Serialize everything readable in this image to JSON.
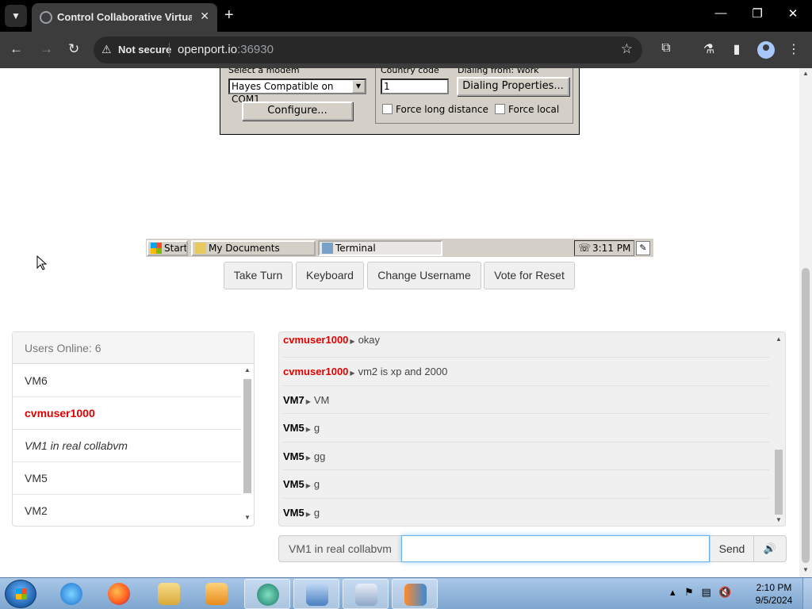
{
  "browser": {
    "tab_title": "Control Collaborative Virtual M",
    "security_label": "Not secure",
    "url_host": "openport.io",
    "url_port": ":36930"
  },
  "vm_screen": {
    "modem_label": "Select a modem",
    "modem_value": "Hayes Compatible on COM1",
    "configure_label": "Configure...",
    "country_code_label": "Country code",
    "country_code_value": "1",
    "dialing_from_label": "Dialing from: Work",
    "dialing_properties_label": "Dialing Properties...",
    "force_long_distance_label": "Force long distance",
    "force_local_label": "Force local",
    "taskbar": {
      "start_label": "Start",
      "task1_label": "My Documents",
      "task2_label": "Terminal",
      "clock": "3:11 PM"
    }
  },
  "controls": {
    "take_turn": "Take Turn",
    "keyboard": "Keyboard",
    "change_username": "Change Username",
    "vote_reset": "Vote for Reset"
  },
  "users": {
    "header": "Users Online: 6",
    "list": [
      "VM6",
      "cvmuser1000",
      "VM1 in real collabvm",
      "VM5",
      "VM2"
    ]
  },
  "chat": {
    "messages": [
      {
        "user": "cvmuser1000",
        "text": "okay"
      },
      {
        "user": "cvmuser1000",
        "text": "vm2 is xp and 2000"
      },
      {
        "user": "VM7",
        "text": "VM"
      },
      {
        "user": "VM5",
        "text": "g"
      },
      {
        "user": "VM5",
        "text": "gg"
      },
      {
        "user": "VM5",
        "text": "g"
      },
      {
        "user": "VM5",
        "text": "g"
      }
    ],
    "username_addon": "VM1 in real collabvm",
    "input_value": "",
    "send_label": "Send"
  },
  "os_taskbar": {
    "time": "2:10 PM",
    "date": "9/5/2024"
  },
  "colors": {
    "self_user": "#e00000",
    "focus_border": "#66afe9",
    "browser_chrome": "#3c3c3c"
  },
  "icons": [
    "search-icon",
    "star-icon",
    "extensions-icon",
    "labs-icon",
    "sidebar-icon",
    "profile-icon",
    "menu-icon",
    "volume-icon"
  ]
}
